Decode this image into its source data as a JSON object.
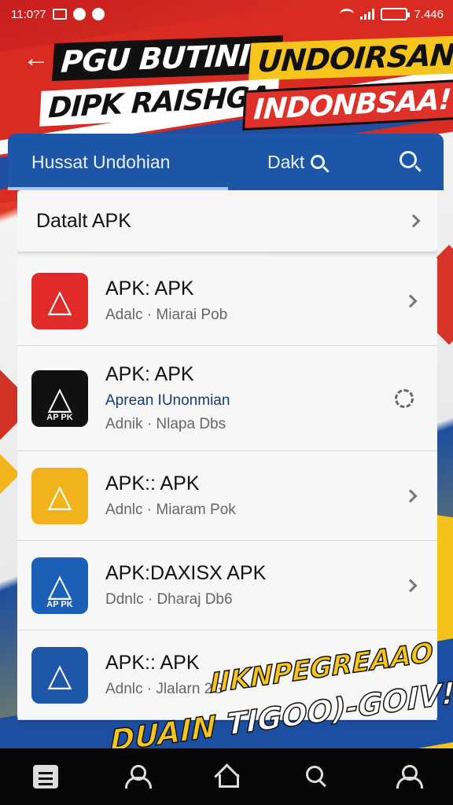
{
  "status_bar": {
    "time": "11:0?7",
    "battery_text": "7.446"
  },
  "header": {
    "back_icon": "arrow-left-icon",
    "headline_line1_a": "PGU BUTININ",
    "headline_line1_b": "UNDOIRSAN",
    "headline_line2_a": "DIPK RAISHGA",
    "headline_line2_b": "INDONBSAA!"
  },
  "tabs": {
    "title": "Hussat Undohian",
    "search_label": "Dakt",
    "search_icon": "search-icon"
  },
  "section": {
    "label": "Datalt APK"
  },
  "apps": [
    {
      "title": "APK: APK",
      "highlight": "",
      "subtitle": "Adalc · Miarai Pob",
      "icon_bg": "#e02b28",
      "icon_caption": "",
      "action": "chevron"
    },
    {
      "title": "APK: APK",
      "highlight": "Aprean IUnonmian",
      "subtitle": "Adnik · Nlapa Dbs",
      "icon_bg": "#111111",
      "icon_caption": "AP PK",
      "action": "sync"
    },
    {
      "title": "APK:: APK",
      "highlight": "",
      "subtitle": "Adnlc · Miaram Pok",
      "icon_bg": "#f2b21c",
      "icon_caption": "",
      "action": "chevron"
    },
    {
      "title": "APK:DAXISX APK",
      "highlight": "",
      "subtitle": "Ddnlc · Dharaj Db6",
      "icon_bg": "#1c5fb7",
      "icon_caption": "AP PK",
      "action": "chevron"
    },
    {
      "title": "APK:: APK",
      "highlight": "",
      "subtitle": "Adnlc · Jlalarn 2G",
      "icon_bg": "#1f57a8",
      "icon_caption": "",
      "action": "none"
    }
  ],
  "banner": {
    "line1": "IIKNPEGREAAO",
    "line2_a": "DUAIN",
    "line2_b": "TIGOO)-GOIV!"
  },
  "bottom_nav": {
    "items": [
      "apps-icon",
      "user-icon",
      "home-icon",
      "search-icon",
      "profile-icon"
    ]
  },
  "colors": {
    "primary_blue": "#1d56a6",
    "accent_red": "#e0302a",
    "accent_yellow": "#f6c51d"
  }
}
